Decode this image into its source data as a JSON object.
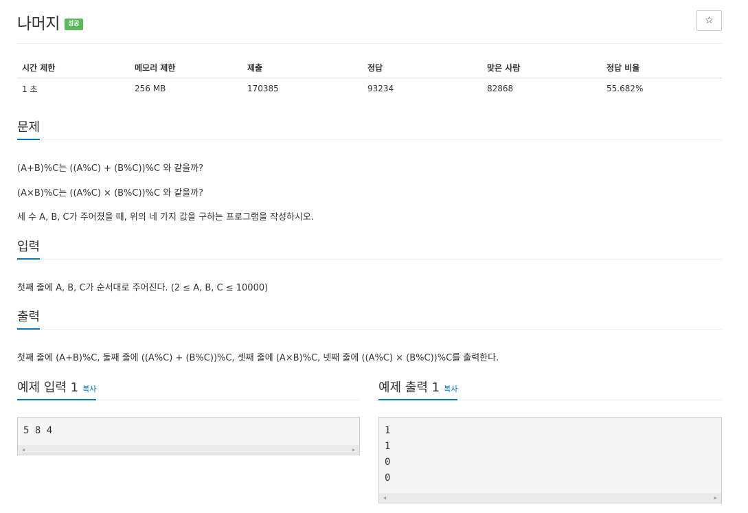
{
  "header": {
    "title": "나머지",
    "badge": "성공",
    "star": "☆"
  },
  "stats": {
    "headers": [
      "시간 제한",
      "메모리 제한",
      "제출",
      "정답",
      "맞은 사람",
      "정답 비율"
    ],
    "values": [
      "1 초",
      "256 MB",
      "170385",
      "93234",
      "82868",
      "55.682%"
    ]
  },
  "problem": {
    "heading": "문제",
    "lines": [
      "(A+B)%C는 ((A%C) + (B%C))%C 와 같을까?",
      "(A×B)%C는 ((A%C) × (B%C))%C 와 같을까?",
      "세 수 A, B, C가 주어졌을 때, 위의 네 가지 값을 구하는 프로그램을 작성하시오."
    ]
  },
  "input": {
    "heading": "입력",
    "text": "첫째 줄에 A, B, C가 순서대로 주어진다. (2 ≤ A, B, C ≤ 10000)"
  },
  "output": {
    "heading": "출력",
    "text": "첫째 줄에 (A+B)%C, 둘째 줄에 ((A%C) + (B%C))%C, 셋째 줄에 (A×B)%C, 넷째 줄에 ((A%C) × (B%C))%C를 출력한다."
  },
  "sample_input": {
    "heading": "예제 입력 1",
    "copy": "복사",
    "lines": [
      "5 8 4"
    ]
  },
  "sample_output": {
    "heading": "예제 출력 1",
    "copy": "복사",
    "lines": [
      "1",
      "1",
      "0",
      "0"
    ]
  }
}
